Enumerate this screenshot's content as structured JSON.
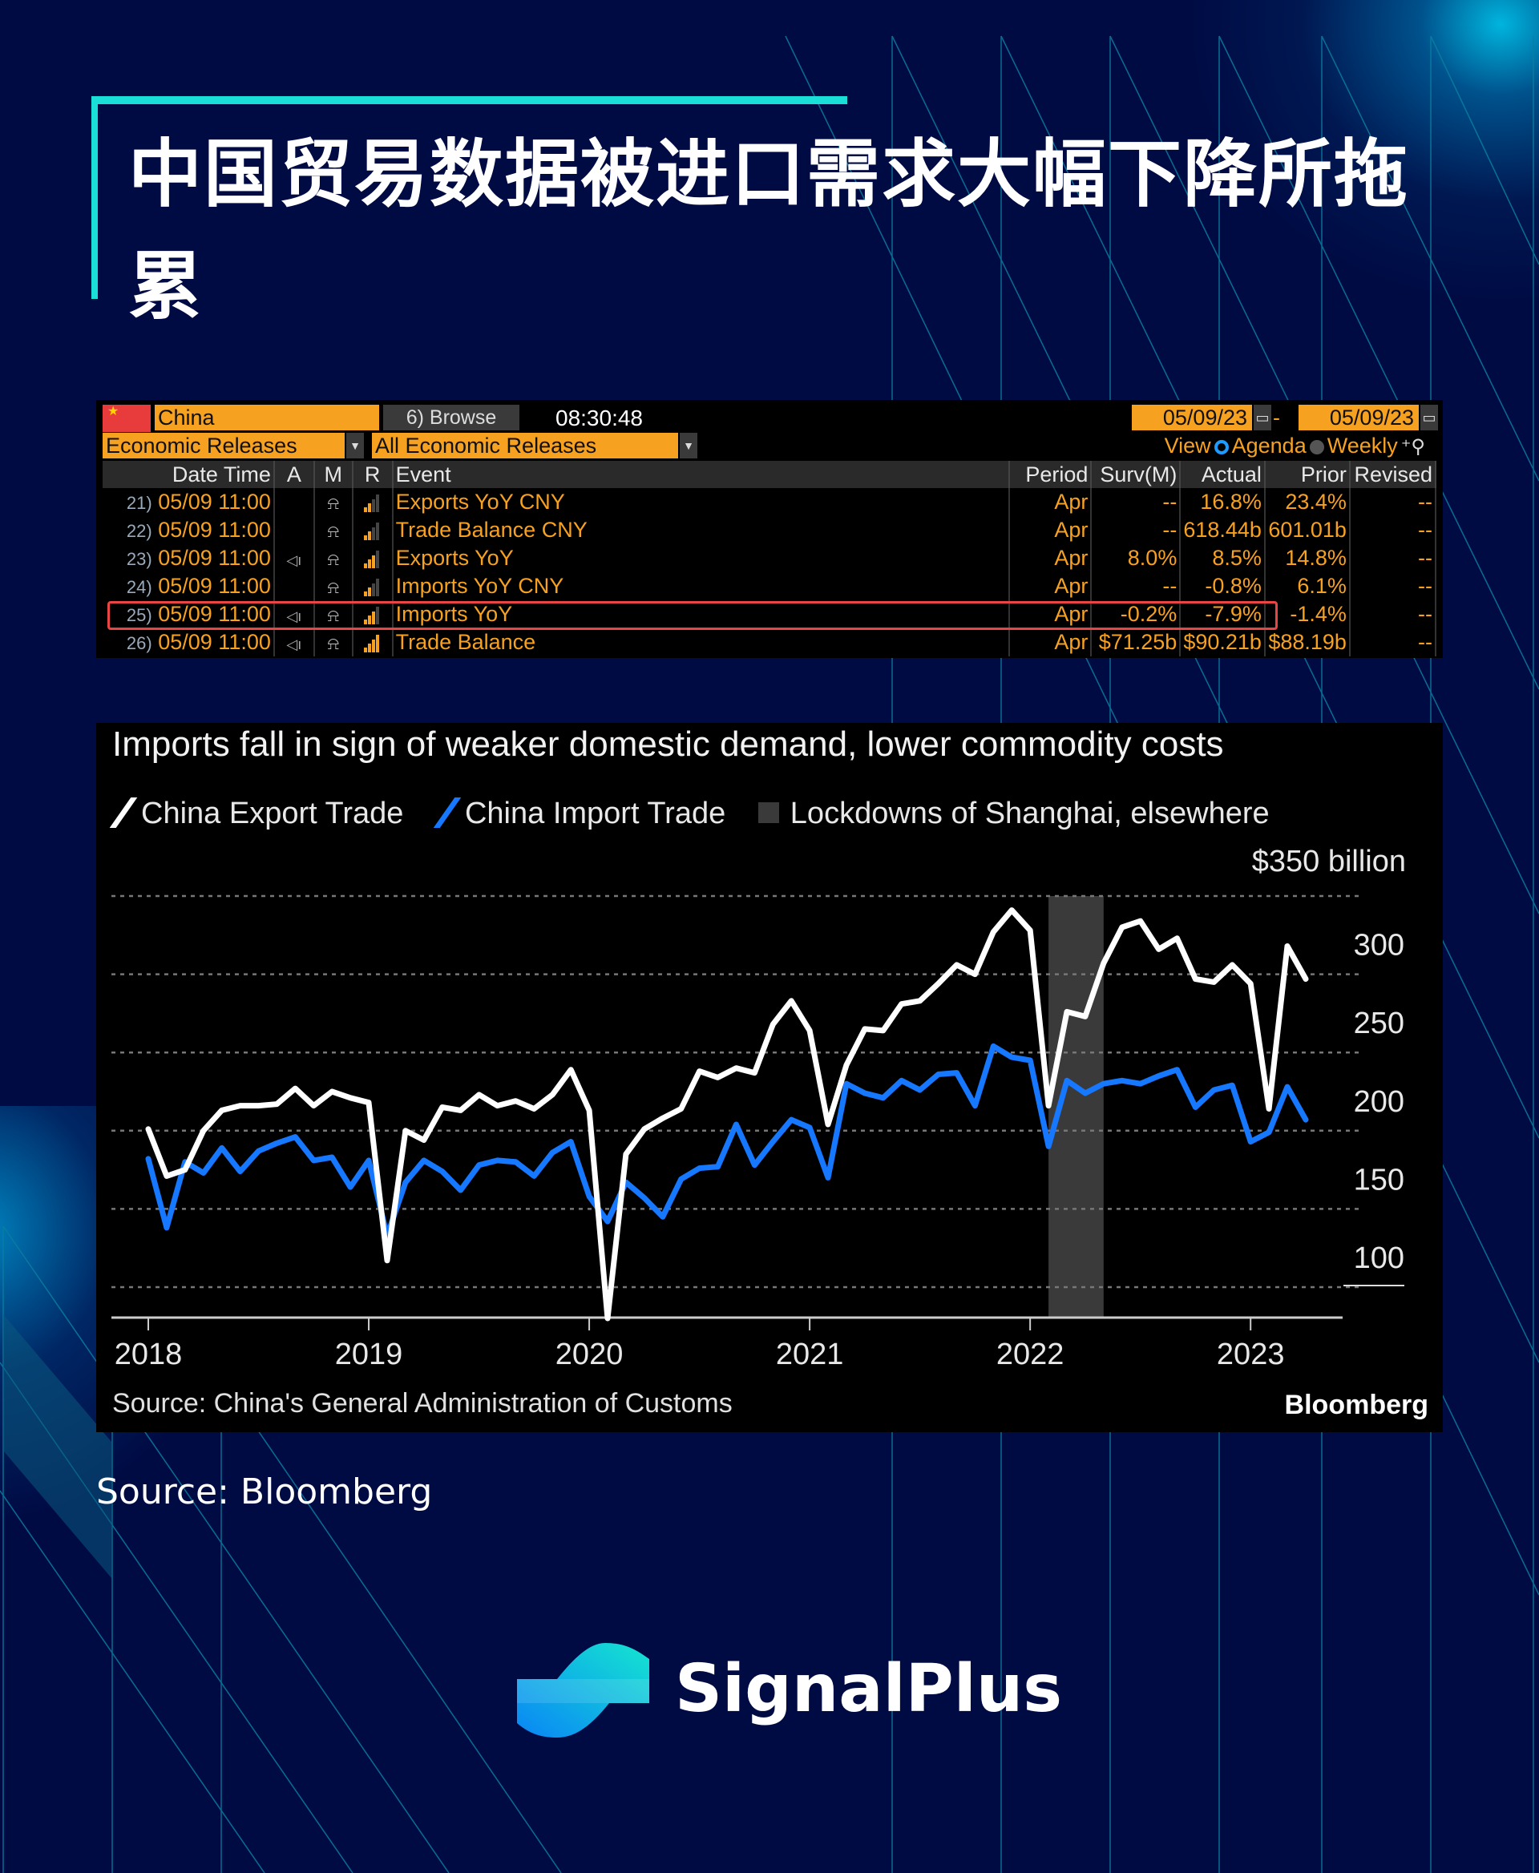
{
  "title": "中国贸易数据被进口需求大幅下降所拖累",
  "terminal": {
    "country": "China",
    "browse_label": "6) Browse",
    "time": "08:30:48",
    "date_from": "05/09/23",
    "date_to": "05/09/23",
    "date_separator": "-",
    "category": "Economic Releases",
    "filter": "All Economic Releases",
    "view_label": "View",
    "view_options": [
      "Agenda",
      "Weekly"
    ],
    "view_selected": "Agenda",
    "columns": [
      "Date Time",
      "A",
      "M",
      "R",
      "Event",
      "Period",
      "Surv(M)",
      "Actual",
      "Prior",
      "Revised"
    ],
    "rows": [
      {
        "num": "21)",
        "datetime": "05/09 11:00",
        "audio": false,
        "relevance": 2,
        "event": "Exports YoY CNY",
        "period": "Apr",
        "surv": "--",
        "actual": "16.8%",
        "prior": "23.4%",
        "revised": "--"
      },
      {
        "num": "22)",
        "datetime": "05/09 11:00",
        "audio": false,
        "relevance": 2,
        "event": "Trade Balance CNY",
        "period": "Apr",
        "surv": "--",
        "actual": "618.44b",
        "prior": "601.01b",
        "revised": "--"
      },
      {
        "num": "23)",
        "datetime": "05/09 11:00",
        "audio": true,
        "relevance": 3,
        "event": "Exports YoY",
        "period": "Apr",
        "surv": "8.0%",
        "actual": "8.5%",
        "prior": "14.8%",
        "revised": "--"
      },
      {
        "num": "24)",
        "datetime": "05/09 11:00",
        "audio": false,
        "relevance": 2,
        "event": "Imports YoY CNY",
        "period": "Apr",
        "surv": "--",
        "actual": "-0.8%",
        "prior": "6.1%",
        "revised": "--"
      },
      {
        "num": "25)",
        "datetime": "05/09 11:00",
        "audio": true,
        "relevance": 3,
        "event": "Imports YoY",
        "period": "Apr",
        "surv": "-0.2%",
        "actual": "-7.9%",
        "prior": "-1.4%",
        "revised": "--",
        "highlighted": true
      },
      {
        "num": "26)",
        "datetime": "05/09 11:00",
        "audio": true,
        "relevance": 4,
        "event": "Trade Balance",
        "period": "Apr",
        "surv": "$71.25b",
        "actual": "$90.21b",
        "prior": "$88.19b",
        "revised": "--"
      }
    ]
  },
  "chart": {
    "source": "Source: China's General Administration of Customs",
    "brand": "Bloomberg"
  },
  "chart_data": {
    "type": "line",
    "title": "Imports fall in sign of weaker domestic demand, lower commodity costs",
    "xlabel": "",
    "ylabel": "$350 billion",
    "unit_label": "$350 billion",
    "x_start": "2018-01",
    "x_frequency": "monthly",
    "x_ticks": [
      "2018",
      "2019",
      "2020",
      "2021",
      "2022",
      "2023"
    ],
    "y_ticks": [
      100,
      150,
      200,
      250,
      300
    ],
    "ylim": [
      80,
      350
    ],
    "grid": true,
    "gridlines": [
      100,
      150,
      200,
      250,
      300,
      350
    ],
    "legend_position": "top-left",
    "shaded_regions": [
      {
        "label": "Lockdowns of Shanghai, elsewhere",
        "start": "2022-02",
        "end": "2022-05",
        "color": "#3a3a3a"
      }
    ],
    "series": [
      {
        "name": "China Export Trade",
        "color": "#ffffff",
        "values": [
          201,
          171,
          175,
          200,
          213,
          216,
          216,
          217,
          227,
          216,
          225,
          221,
          218,
          117,
          200,
          194,
          215,
          213,
          223,
          216,
          219,
          214,
          223,
          239,
          213,
          80,
          185,
          201,
          208,
          214,
          238,
          234,
          240,
          237,
          268,
          283,
          264,
          204,
          242,
          265,
          264,
          281,
          283,
          294,
          306,
          300,
          327,
          341,
          328,
          216,
          276,
          273,
          307,
          330,
          334,
          316,
          323,
          297,
          295,
          306,
          294,
          214,
          318,
          297
        ]
      },
      {
        "name": "China Import Trade",
        "color": "#1677ff",
        "values": [
          182,
          138,
          180,
          173,
          189,
          174,
          187,
          192,
          196,
          181,
          183,
          164,
          181,
          133,
          167,
          181,
          174,
          162,
          178,
          181,
          180,
          171,
          186,
          193,
          158,
          142,
          167,
          157,
          145,
          169,
          176,
          177,
          204,
          178,
          193,
          207,
          202,
          170,
          230,
          224,
          221,
          232,
          226,
          236,
          237,
          216,
          254,
          247,
          245,
          190,
          232,
          224,
          230,
          232,
          230,
          235,
          239,
          215,
          226,
          229,
          193,
          199,
          228,
          207
        ]
      }
    ]
  },
  "page_source": "Source: Bloomberg",
  "brand_name": "SignalPlus"
}
